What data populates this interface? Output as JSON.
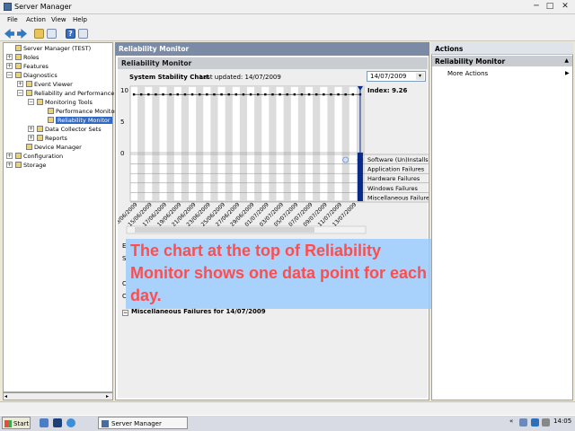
{
  "window": {
    "title": "Server Manager",
    "minimize": "─",
    "maximize": "□",
    "close": "✕"
  },
  "menu": [
    "File",
    "Action",
    "View",
    "Help"
  ],
  "toolbar_icons": [
    "back-icon",
    "forward-icon",
    "up-folder-icon",
    "show-hide-tree-icon",
    "help-icon",
    "properties-icon"
  ],
  "tree": {
    "items": [
      {
        "label": "Server Manager (TEST)",
        "expander": "",
        "icon": "server-icon"
      },
      {
        "label": "Roles",
        "expander": "+",
        "icon": "roles-icon"
      },
      {
        "label": "Features",
        "expander": "+",
        "icon": "features-icon"
      },
      {
        "label": "Diagnostics",
        "expander": "−",
        "icon": "diagnostics-icon"
      },
      {
        "label": "Event Viewer",
        "expander": "+",
        "icon": "event-viewer-icon"
      },
      {
        "label": "Reliability and Performance",
        "expander": "−",
        "icon": "reliability-icon"
      },
      {
        "label": "Monitoring Tools",
        "expander": "−",
        "icon": "folder-icon"
      },
      {
        "label": "Performance Monitor",
        "expander": "",
        "icon": "performance-monitor-icon"
      },
      {
        "label": "Reliability Monitor",
        "expander": "",
        "icon": "reliability-monitor-icon"
      },
      {
        "label": "Data Collector Sets",
        "expander": "+",
        "icon": "folder-icon"
      },
      {
        "label": "Reports",
        "expander": "+",
        "icon": "reports-icon"
      },
      {
        "label": "Device Manager",
        "expander": "",
        "icon": "device-manager-icon"
      },
      {
        "label": "Configuration",
        "expander": "+",
        "icon": "configuration-icon"
      },
      {
        "label": "Storage",
        "expander": "+",
        "icon": "storage-icon"
      }
    ]
  },
  "center": {
    "pane_title": "Reliability Monitor",
    "sub_title": "Reliability Monitor",
    "chart_title": "System Stability Chart",
    "last_updated": "Last updated: 14/07/2009",
    "date_selected": "14/07/2009",
    "misc_failures": "Miscellaneous Failures for 14/07/2009",
    "section_letters": [
      "E",
      "S",
      "C",
      "C"
    ]
  },
  "overlay": {
    "text": "The chart at the top of Reliability Monitor shows one data point for each day."
  },
  "actions": {
    "header": "Actions",
    "section": "Reliability Monitor",
    "more": "More Actions"
  },
  "taskbar": {
    "start": "Start",
    "task": "Server Manager",
    "clock": "14:05"
  },
  "chart_data": {
    "type": "line",
    "ylim": [
      0,
      10
    ],
    "y_ticks": [
      "10",
      "5",
      "0"
    ],
    "index_label": "Index: 9.26",
    "x": [
      "13/06/2009",
      "15/06/2009",
      "17/06/2009",
      "19/06/2009",
      "21/06/2009",
      "23/06/2009",
      "25/06/2009",
      "27/06/2009",
      "29/06/2009",
      "01/07/2009",
      "03/07/2009",
      "05/07/2009",
      "07/07/2009",
      "09/07/2009",
      "11/07/2009",
      "13/07/2009"
    ],
    "series": [
      {
        "values": [
          9.26,
          9.26,
          9.26,
          9.26,
          9.26,
          9.26,
          9.26,
          9.26,
          9.26,
          9.26,
          9.26,
          9.26,
          9.26,
          9.26,
          9.26,
          9.26,
          9.26,
          9.26,
          9.26,
          9.26,
          9.26,
          9.26,
          9.26,
          9.26,
          9.26,
          9.26,
          9.26,
          9.26,
          9.26,
          9.26,
          9.26,
          9.26
        ]
      }
    ],
    "failure_rows": [
      "Software (Un)Installs",
      "Application Failures",
      "Hardware Failures",
      "Windows Failures",
      "Miscellaneous Failures"
    ],
    "info_events_on_days": [
      29,
      31
    ],
    "selected_day": 31,
    "grid": true
  }
}
